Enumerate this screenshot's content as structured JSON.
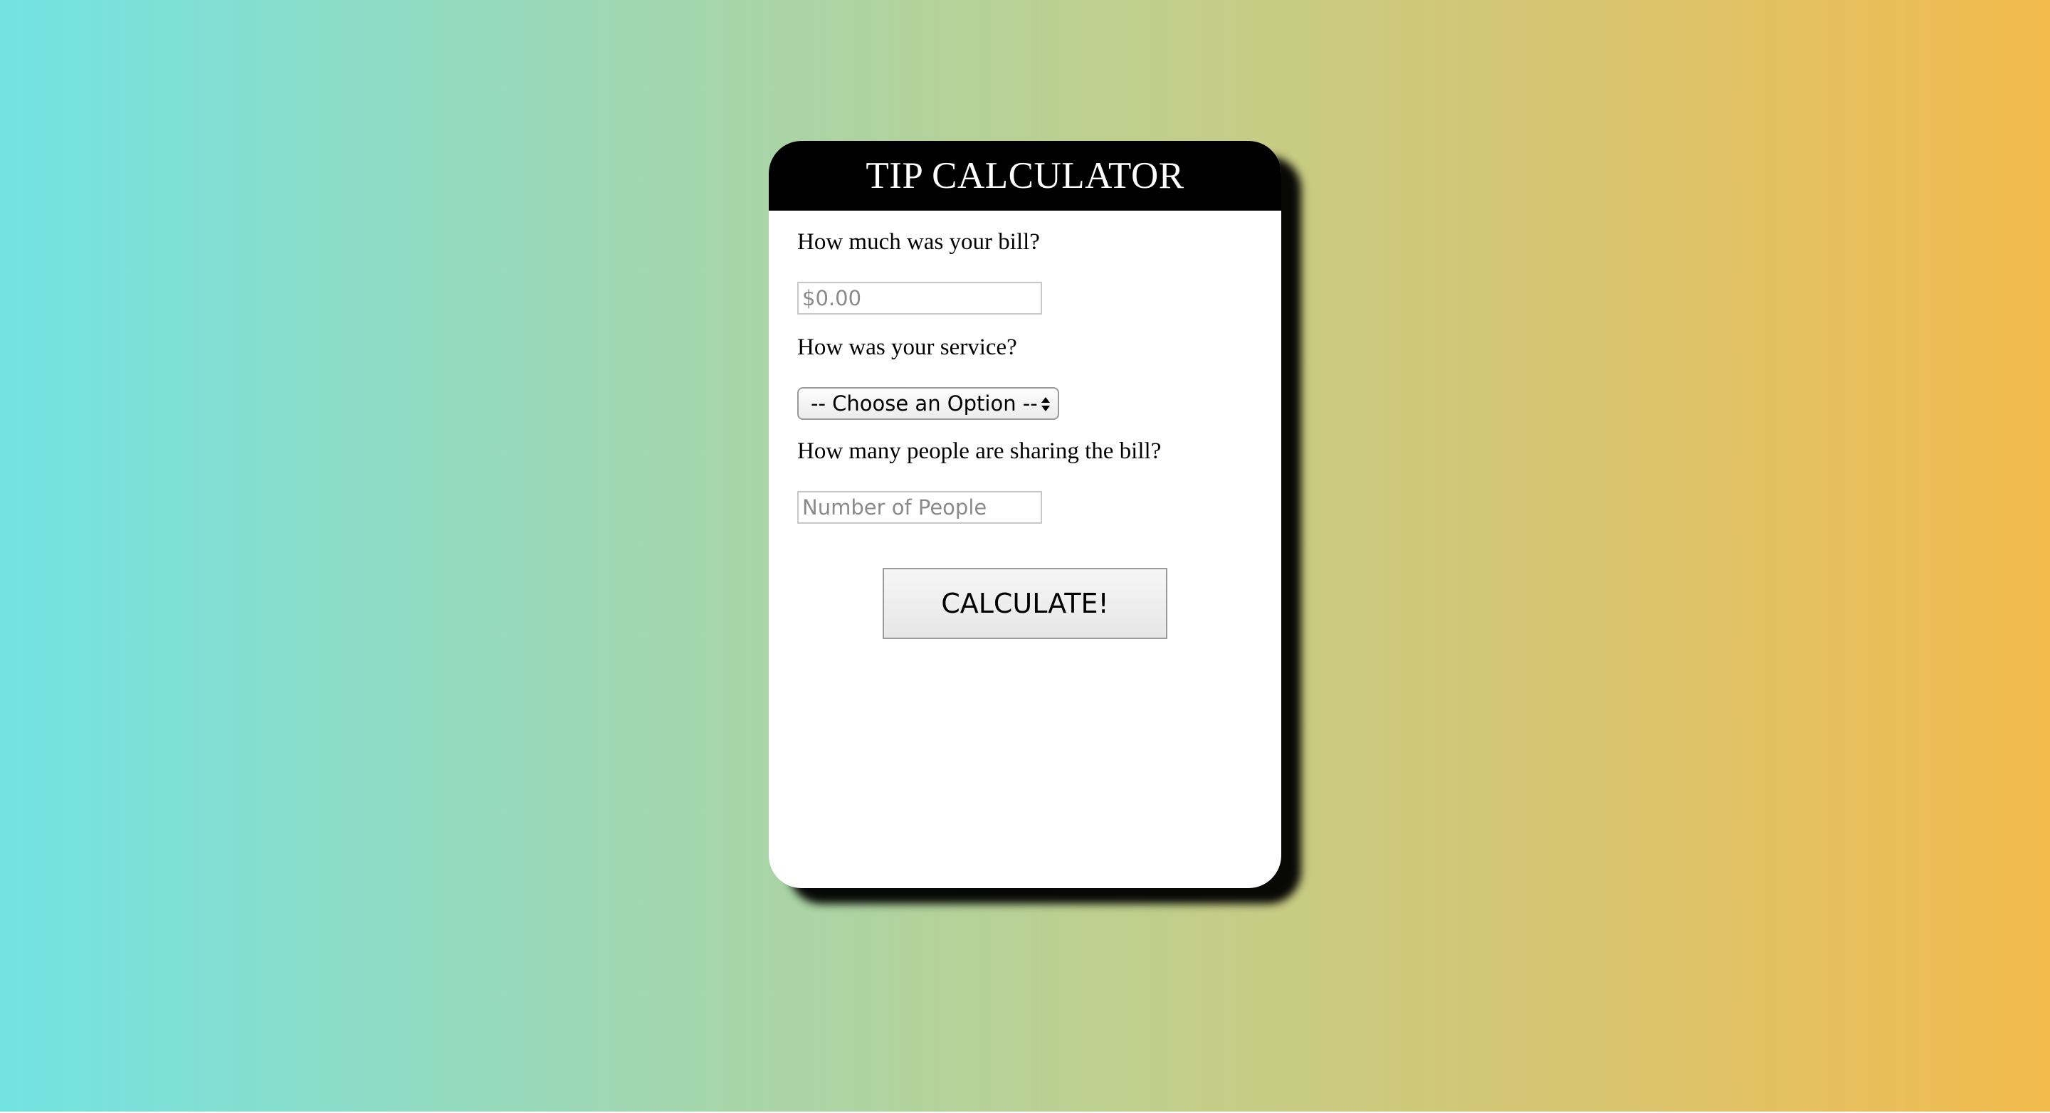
{
  "app": {
    "title": "TIP CALCULATOR"
  },
  "form": {
    "bill_label": "How much was your bill?",
    "bill_placeholder": "$0.00",
    "service_label": "How was your service?",
    "service_selected": "-- Choose an Option --",
    "people_label": "How many people are sharing the bill?",
    "people_placeholder": "Number of People",
    "calculate_label": "CALCULATE!"
  },
  "icons": {
    "select_arrows": "chevron-up-down-icon"
  },
  "colors": {
    "gradient_start": "#72e3e3",
    "gradient_end": "#f2bb4c",
    "header_bg": "#000000",
    "card_bg": "#ffffff"
  }
}
